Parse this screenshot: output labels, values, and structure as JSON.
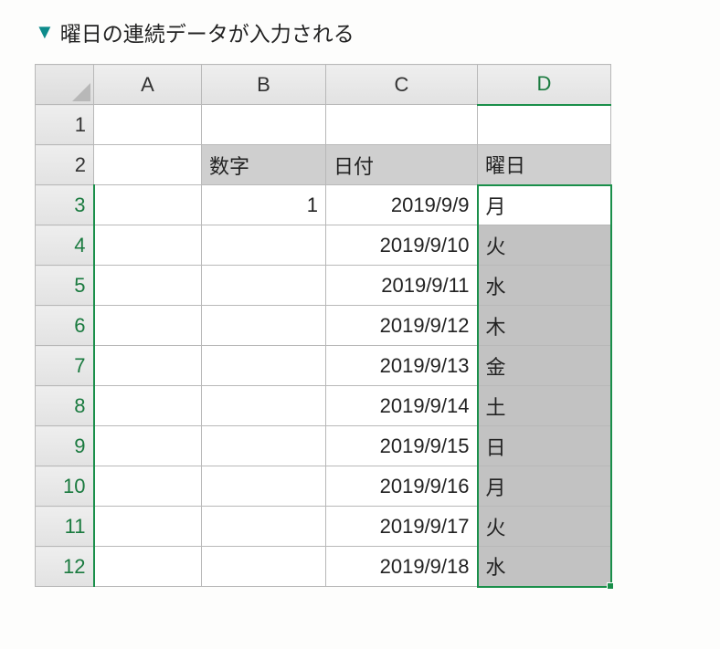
{
  "caption": "曜日の連続データが入力される",
  "columns": [
    "A",
    "B",
    "C",
    "D"
  ],
  "row_numbers": [
    1,
    2,
    3,
    4,
    5,
    6,
    7,
    8,
    9,
    10,
    11,
    12
  ],
  "headers": {
    "B": "数字",
    "C": "日付",
    "D": "曜日"
  },
  "rows": [
    {
      "B": "1",
      "C": "2019/9/9",
      "D": "月"
    },
    {
      "B": "",
      "C": "2019/9/10",
      "D": "火"
    },
    {
      "B": "",
      "C": "2019/9/11",
      "D": "水"
    },
    {
      "B": "",
      "C": "2019/9/12",
      "D": "木"
    },
    {
      "B": "",
      "C": "2019/9/13",
      "D": "金"
    },
    {
      "B": "",
      "C": "2019/9/14",
      "D": "土"
    },
    {
      "B": "",
      "C": "2019/9/15",
      "D": "日"
    },
    {
      "B": "",
      "C": "2019/9/16",
      "D": "月"
    },
    {
      "B": "",
      "C": "2019/9/17",
      "D": "火"
    },
    {
      "B": "",
      "C": "2019/9/18",
      "D": "水"
    }
  ],
  "selected_column": "D",
  "active_cell": "D3",
  "selection_range": "D3:D12",
  "colors": {
    "accent": "#0d8b8b",
    "selection": "#1a8f4a",
    "header_fill": "#cfcfcf",
    "fill_dark": "#c2c2c2"
  },
  "chart_data": {
    "type": "table",
    "title": "曜日の連続データが入力される",
    "columns": [
      "数字",
      "日付",
      "曜日"
    ],
    "data": [
      [
        1,
        "2019/9/9",
        "月"
      ],
      [
        null,
        "2019/9/10",
        "火"
      ],
      [
        null,
        "2019/9/11",
        "水"
      ],
      [
        null,
        "2019/9/12",
        "木"
      ],
      [
        null,
        "2019/9/13",
        "金"
      ],
      [
        null,
        "2019/9/14",
        "土"
      ],
      [
        null,
        "2019/9/15",
        "日"
      ],
      [
        null,
        "2019/9/16",
        "月"
      ],
      [
        null,
        "2019/9/17",
        "火"
      ],
      [
        null,
        "2019/9/18",
        "水"
      ]
    ]
  }
}
